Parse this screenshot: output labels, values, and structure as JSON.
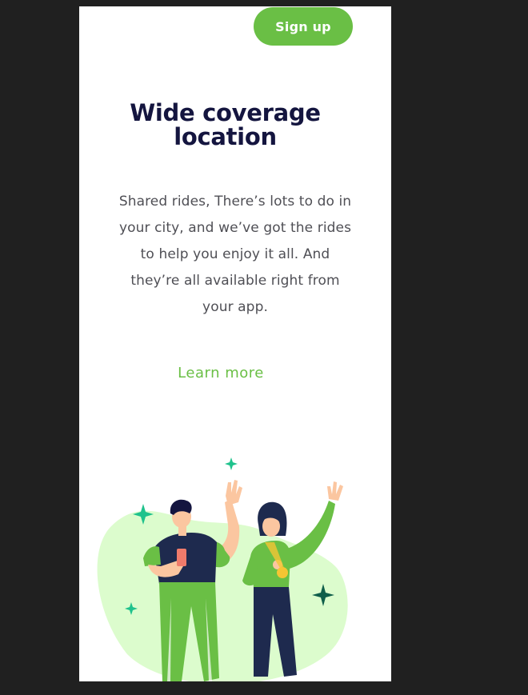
{
  "header": {
    "signup_label": "Sign up"
  },
  "hero": {
    "title_line1": "Wide coverage",
    "title_line2": "location",
    "description": "Shared rides, There’s lots to do in your city, and we’ve got the rides to help you enjoy it all. And they’re all available right from your app.",
    "learn_more_label": "Learn more"
  },
  "colors": {
    "accent": "#6abf45",
    "title": "#14153f",
    "body_text": "#4f4f55",
    "background_blob": "#dcfccd",
    "sparkle_teal": "#1fc28c",
    "sparkle_dark": "#0f5e4a",
    "navy": "#1e2a4e"
  },
  "illustration": {
    "icons": [
      "sparkle-icon",
      "waving-man",
      "waving-woman",
      "phone-icon",
      "medal-icon"
    ]
  }
}
